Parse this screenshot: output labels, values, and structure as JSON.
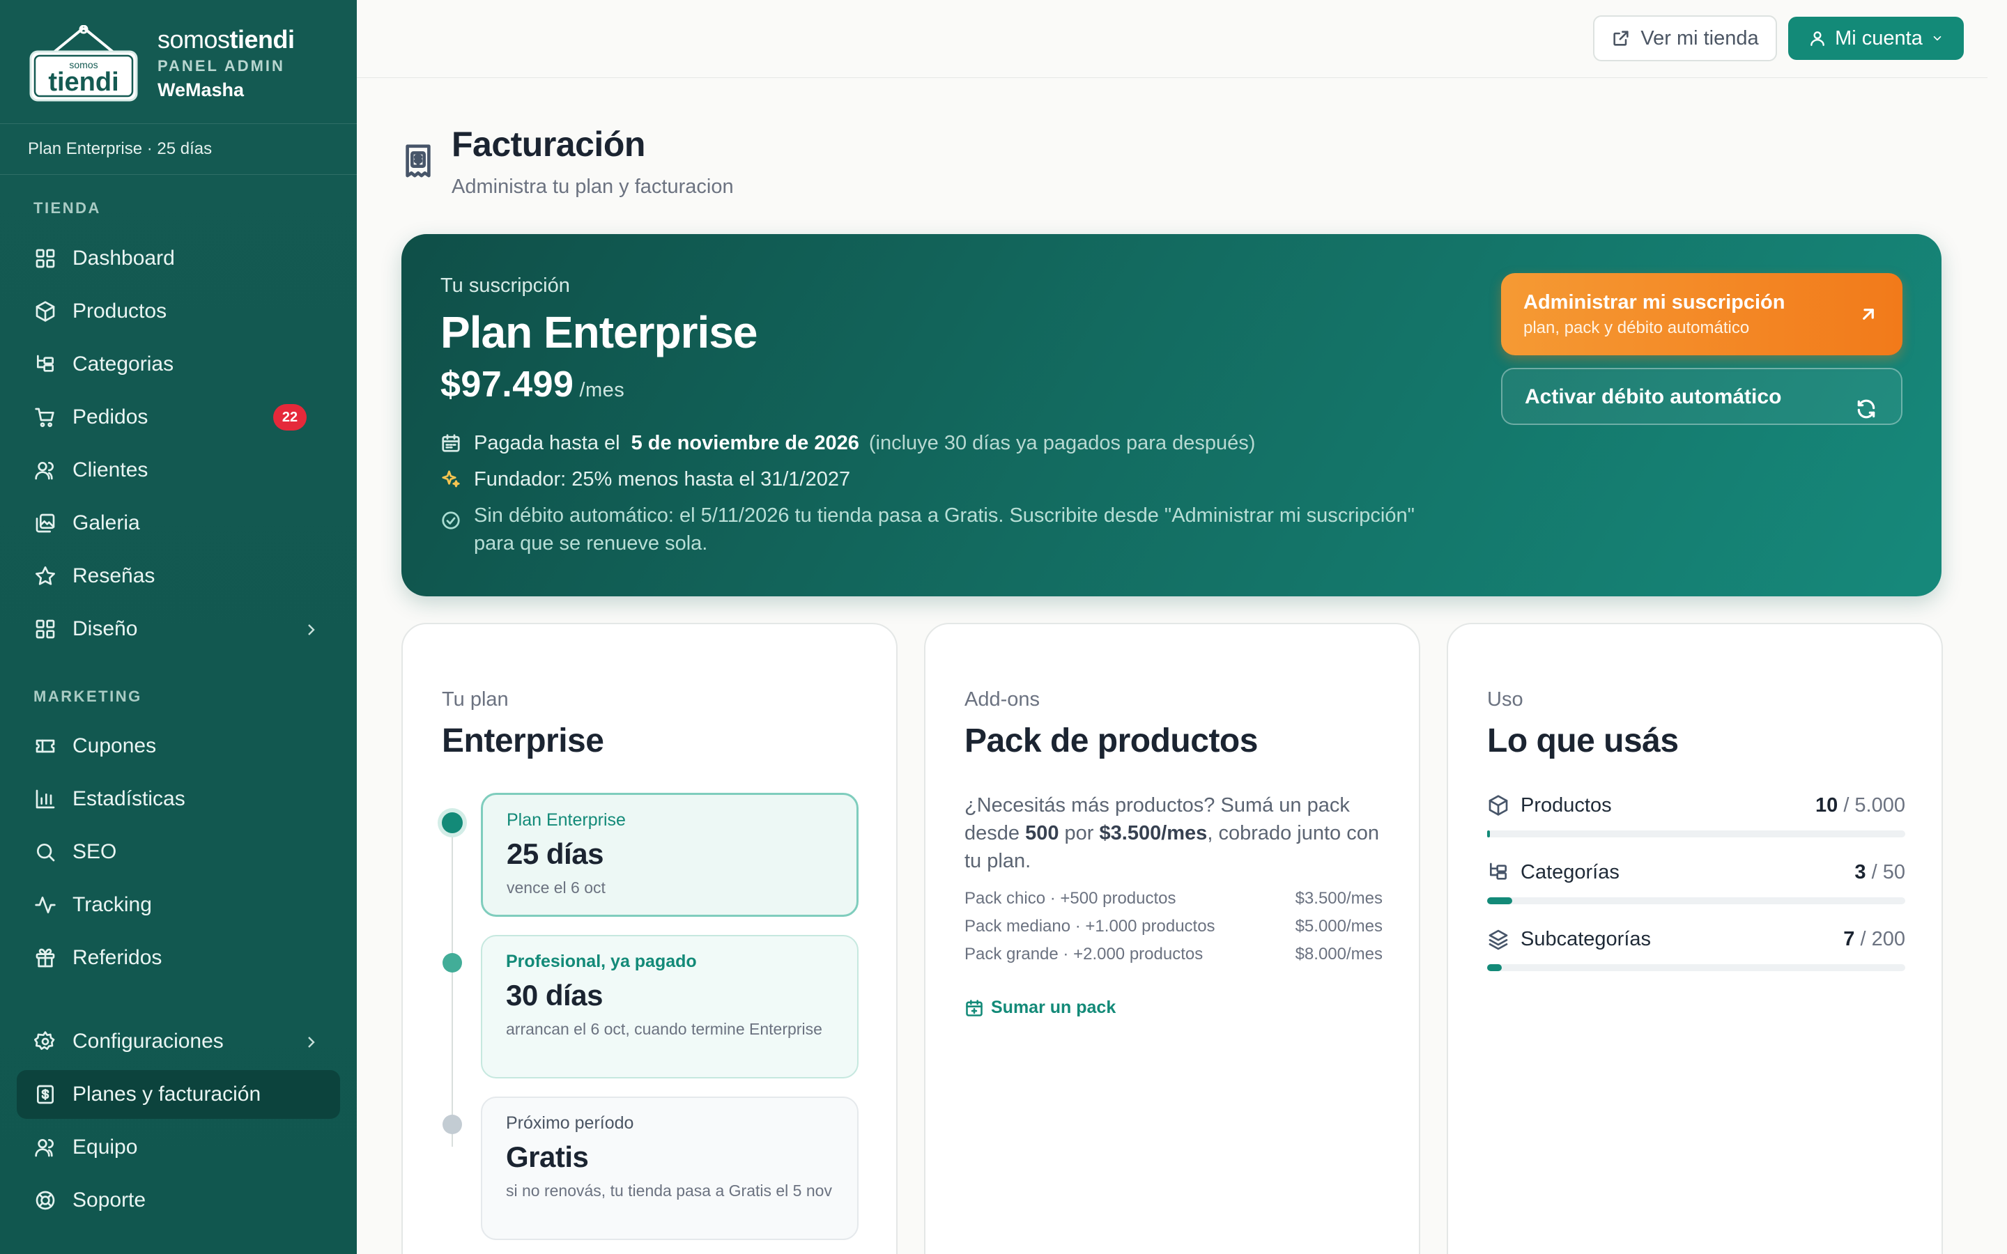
{
  "brand": {
    "name_light": "somos",
    "name_bold": "tiendi",
    "panel": "PANEL ADMIN",
    "store": "WeMasha",
    "logo_small": "somos",
    "logo_big": "tiendi"
  },
  "sidebar": {
    "plan_strip": "Plan Enterprise · 25 días",
    "section_store": "TIENDA",
    "section_marketing": "MARKETING",
    "items": [
      {
        "label": "Dashboard",
        "icon": "grid-icon"
      },
      {
        "label": "Productos",
        "icon": "box-icon"
      },
      {
        "label": "Categorias",
        "icon": "tree-icon"
      },
      {
        "label": "Pedidos",
        "icon": "cart-icon",
        "badge": "22"
      },
      {
        "label": "Clientes",
        "icon": "users-icon"
      },
      {
        "label": "Galeria",
        "icon": "images-icon"
      },
      {
        "label": "Reseñas",
        "icon": "star-icon"
      },
      {
        "label": "Diseño",
        "icon": "layout-icon"
      },
      {
        "label": "Cupones",
        "icon": "ticket-icon"
      },
      {
        "label": "Estadísticas",
        "icon": "chart-icon"
      },
      {
        "label": "SEO",
        "icon": "search-icon"
      },
      {
        "label": "Tracking",
        "icon": "activity-icon"
      },
      {
        "label": "Referidos",
        "icon": "gift-icon"
      },
      {
        "label": "Configuraciones",
        "icon": "gear-icon"
      },
      {
        "label": "Planes y facturación",
        "icon": "receipt-icon"
      },
      {
        "label": "Equipo",
        "icon": "team-icon"
      },
      {
        "label": "Soporte",
        "icon": "lifebuoy-icon"
      }
    ]
  },
  "topbar": {
    "store_button": "Ver mi tienda",
    "account_button": "Mi cuenta"
  },
  "page": {
    "title": "Facturación",
    "subtitle": "Administra tu plan y facturacion"
  },
  "hero": {
    "kicker": "Tu suscripción",
    "plan": "Plan Enterprise",
    "price": "$97.499",
    "per": "/mes",
    "paid_prefix": "Pagada hasta el",
    "paid_date": "5 de noviembre de 2026",
    "paid_note": "(incluye 30 días ya pagados para después)",
    "founder": "Fundador: 25% menos hasta el 31/1/2027",
    "no_debit_1": "Sin débito automático: el 5/11/2026 tu tienda pasa a Gratis. Suscribite desde \"Administrar mi suscripción\"",
    "no_debit_2": "para que se renueve sola.",
    "primary_title": "Administrar mi suscripción",
    "primary_sub": "plan, pack y débito automático",
    "secondary": "Activar débito automático",
    "colors": {
      "primary": "#f27a1a",
      "accent": "#138a78"
    }
  },
  "plan_card": {
    "kicker": "Tu plan",
    "title": "Enterprise",
    "periods": [
      {
        "label": "Plan Enterprise",
        "big": "25 días",
        "note": "vence el 6 oct"
      },
      {
        "label": "Profesional, ya pagado",
        "big": "30 días",
        "note": "arrancan el 6 oct, cuando termine Enterprise"
      },
      {
        "label": "Próximo período",
        "big": "Gratis",
        "note": "si no renovás, tu tienda pasa a Gratis el 5 nov"
      }
    ]
  },
  "addons_card": {
    "kicker": "Add-ons",
    "title": "Pack de productos",
    "desc_1": "¿Necesitás más productos? Sumá un pack desde",
    "desc_qty": "500",
    "desc_2": "por",
    "desc_price": "$3.500/mes",
    "desc_3": ", cobrado junto con tu plan.",
    "packs": [
      {
        "name": "Pack chico · +500 productos",
        "price": "$3.500/mes"
      },
      {
        "name": "Pack mediano · +1.000 productos",
        "price": "$5.000/mes"
      },
      {
        "name": "Pack grande · +2.000 productos",
        "price": "$8.000/mes"
      }
    ],
    "link": "Sumar un pack"
  },
  "usage_card": {
    "kicker": "Uso",
    "title": "Lo que usás",
    "rows": [
      {
        "label": "Productos",
        "used": "10",
        "limit": "/ 5.000",
        "fraction": 0.002
      },
      {
        "label": "Categorías",
        "used": "3",
        "limit": "/ 50",
        "fraction": 0.06
      },
      {
        "label": "Subcategorías",
        "used": "7",
        "limit": "/ 200",
        "fraction": 0.035
      }
    ]
  }
}
